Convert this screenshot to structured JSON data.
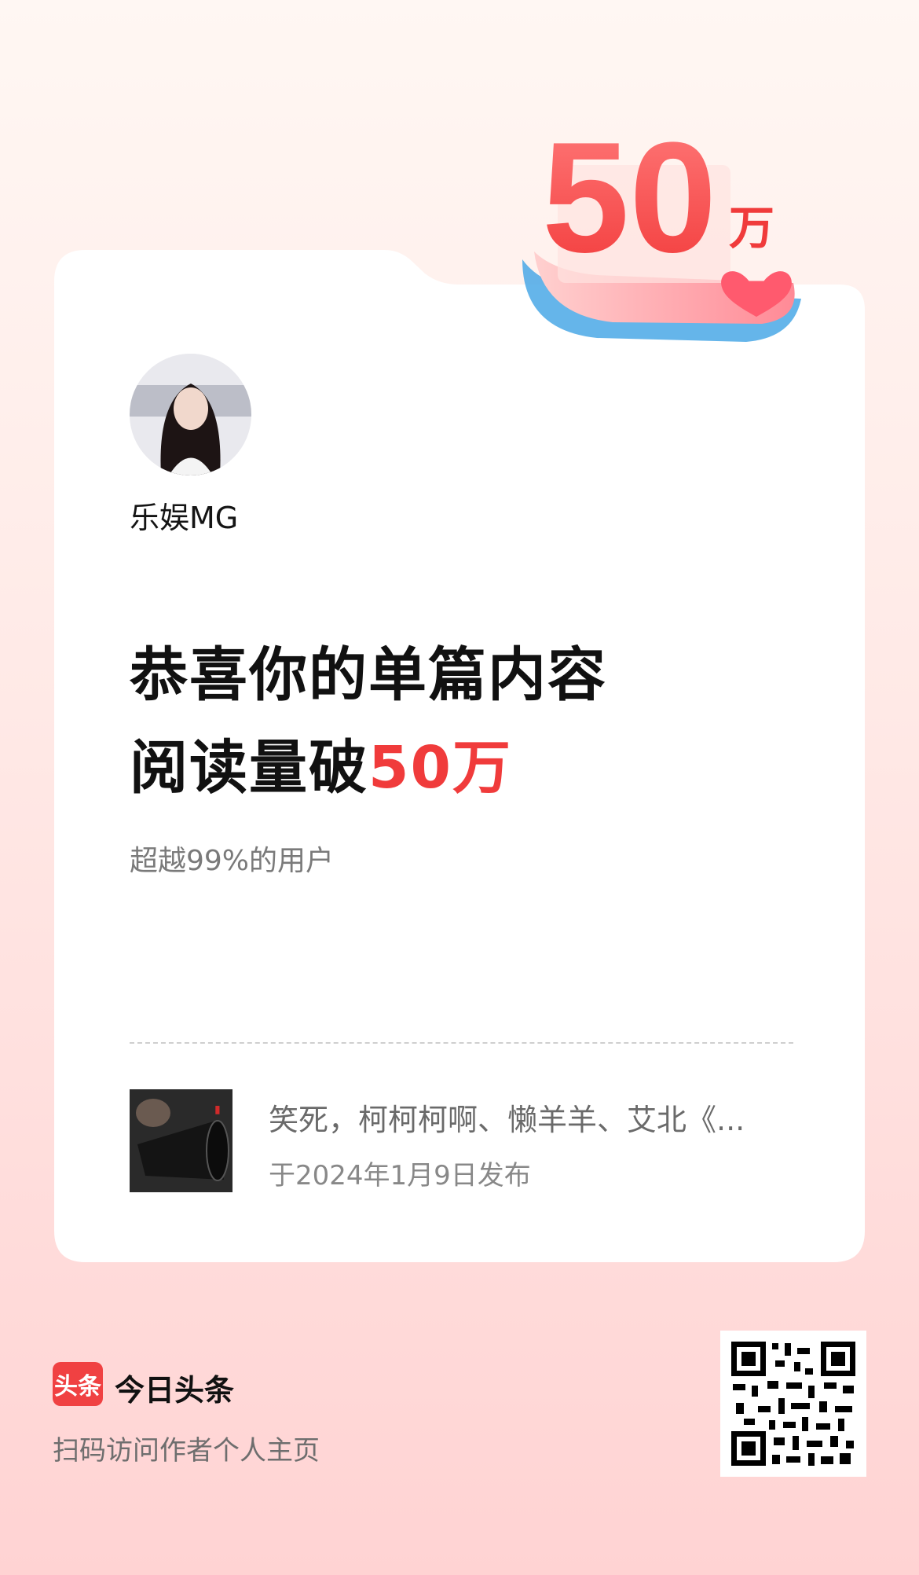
{
  "milestone": {
    "big_number": "50",
    "unit": "万"
  },
  "author": {
    "name": "乐娱MG"
  },
  "headline": {
    "line1": "恭喜你的单篇内容",
    "line2_prefix": "阅读量破",
    "line2_highlight": "50万"
  },
  "subline": "超越99%的用户",
  "article": {
    "title": "笑死，柯柯柯啊、懒羊羊、艾北《...",
    "publish_text": "于2024年1月9日发布"
  },
  "footer": {
    "logo_text": "头条",
    "brand_name": "今日头条",
    "scan_hint": "扫码访问作者个人主页"
  },
  "colors": {
    "accent": "#f03b3b",
    "brand_red": "#f04142"
  }
}
